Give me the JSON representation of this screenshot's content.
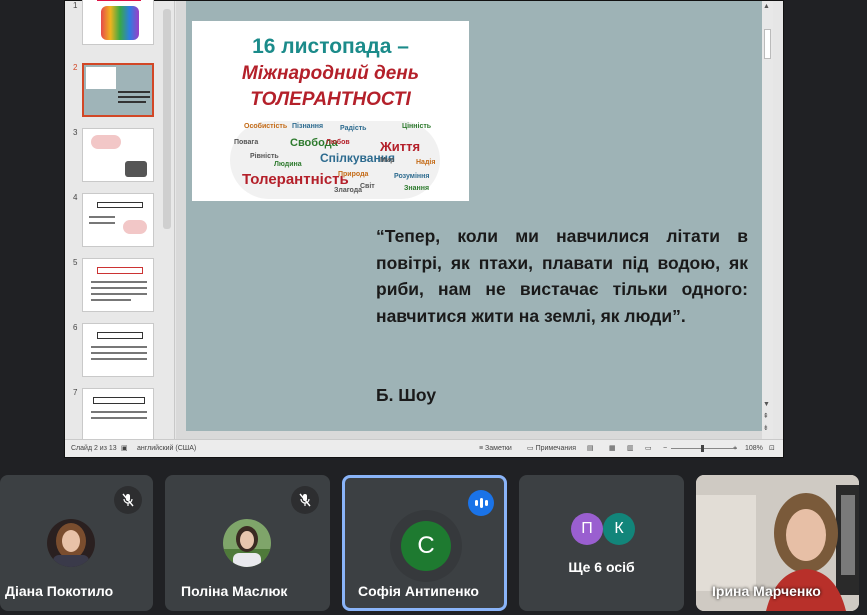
{
  "presentation": {
    "thumb_numbers": [
      "1",
      "2",
      "3",
      "4",
      "5",
      "6",
      "7"
    ],
    "banner": {
      "line1": "16 листопада –",
      "line2": "Міжнародний день",
      "line3": "ТОЛЕРАНТНОСТІ",
      "cloud_words": [
        "Толерантність",
        "Спілкування",
        "Життя",
        "Свобода",
        "Особистість",
        "Повага",
        "Цінність",
        "Рівність",
        "Пізнання",
        "Радість",
        "Мир",
        "Любов",
        "Природа",
        "Людина",
        "Світ",
        "Розуміння",
        "Знання",
        "Злагода",
        "Надія"
      ]
    },
    "quote": "“Тепер, коли ми навчилися літати в повітрі, як птахи, плавати під водою, як риби,  нам не вистачає тільки одного: навчитися жити на землі, як люди”.",
    "author": "Б. Шоу",
    "status_bar": {
      "slide_info": "Слайд 2 из 13",
      "language": "английский (США)",
      "notes": "Заметки",
      "comments": "Примечания",
      "zoom": "108%"
    }
  },
  "participants": [
    {
      "name": "Діана Покотило",
      "mic_muted": true
    },
    {
      "name": "Поліна Маслюк",
      "mic_muted": true
    },
    {
      "name": "Софія Антипенко",
      "initial": "С",
      "speaking": true,
      "avatar_color": "#1e7a30"
    },
    {
      "more_label": "Ще 6 осіб",
      "initials": [
        "П",
        "К"
      ],
      "colors": [
        "#9a5fd0",
        "#12857a"
      ]
    },
    {
      "name": "Ірина Марченко"
    }
  ]
}
